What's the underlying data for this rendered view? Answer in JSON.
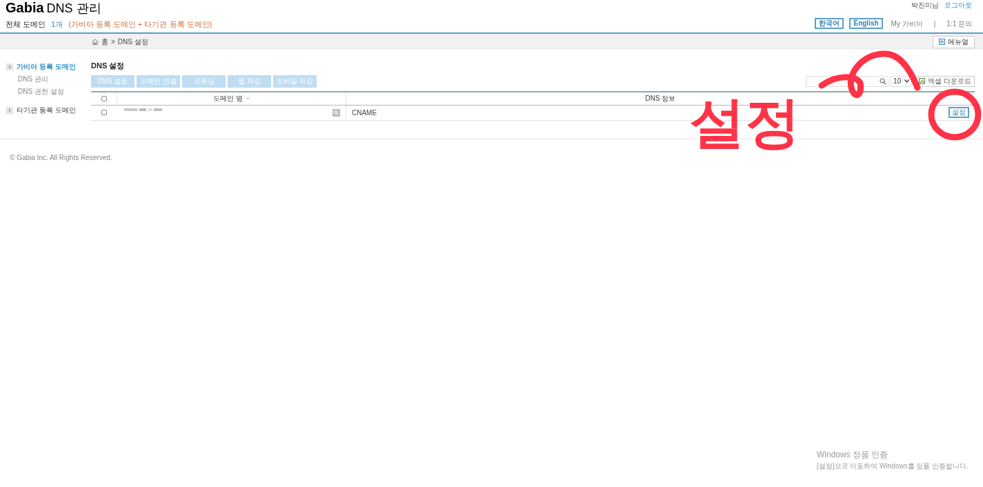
{
  "header": {
    "logo": "Gabia",
    "title": "DNS 관리",
    "user_name": "박진미님",
    "logout": "로그아웃",
    "summary_label": "전체 도메인",
    "count": "1개",
    "summary_note": "(가비아 등록 도메인 + 타기관 등록 도메인)",
    "languages": [
      "한국어",
      "English"
    ],
    "links": [
      "My 가비아",
      "1:1 문의"
    ],
    "link_separator": "|"
  },
  "breadcrumb": {
    "items": [
      "홈",
      "DNS 설정"
    ],
    "separator": ">",
    "manual_button": "메뉴얼"
  },
  "sidebar": [
    {
      "label": "가비아 등록 도메인",
      "selected": true,
      "children": [
        "DNS 관리",
        "DNS 권한 설정"
      ]
    },
    {
      "label": "타기관 등록 도메인",
      "selected": false
    }
  ],
  "content": {
    "title": "DNS 설정",
    "toolbar": [
      {
        "label": "DNS 설정",
        "disabled": true
      },
      {
        "label": "도메인 연결",
        "disabled": true
      },
      {
        "label": "포워딩",
        "disabled": true
      },
      {
        "label": "웹 파킹",
        "disabled": true
      },
      {
        "label": "모바일 파킹",
        "disabled": true
      }
    ],
    "page_size": "10",
    "excel_button": "엑셀 다운로드",
    "table": {
      "all_checked": false,
      "columns": [
        {
          "label": "도메인 명",
          "sorted": true
        },
        {
          "label": "DNS 정보",
          "sorted": false
        }
      ],
      "rows": [
        {
          "checked": false,
          "domain_redacted": true,
          "dns_info": "CNAME",
          "action": "설정"
        }
      ]
    }
  },
  "footer": "© Gabia Inc. All Rights Reserved.",
  "annotation": {
    "text": "설정"
  },
  "os_notice": {
    "title": "Windows 정품 인증",
    "message": "[설정]으로 이동하여 Windows를 정품 인증합니다."
  }
}
